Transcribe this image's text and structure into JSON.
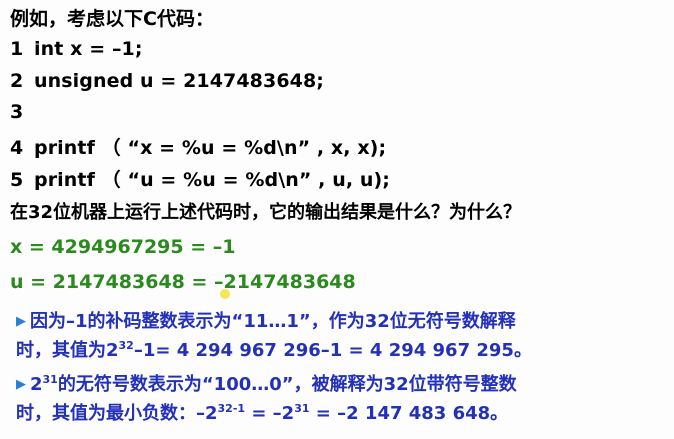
{
  "intro": "例如，考虑以下C代码：",
  "code_lines": [
    {
      "num": "1",
      "text": "int x = –1;"
    },
    {
      "num": "2",
      "text": "unsigned u = 2147483648;"
    },
    {
      "num": "3",
      "text": ""
    },
    {
      "num": "4",
      "text": "printf （ “x = %u = %d\\n” , x, x);"
    },
    {
      "num": "5",
      "text": "printf （ “u = %u = %d\\n” , u, u);"
    }
  ],
  "question": "在32位机器上运行上述代码时，它的输出结果是什么？为什么？",
  "answers": [
    "x = 4294967295 = –1",
    "u = 2147483648 = –2147483648"
  ],
  "explanations": {
    "e1_line1": "因为–1的补码整数表示为“11…1”，作为32位无符号数解释",
    "e1_line2_a": "时，其值为2",
    "e1_line2_sup": "32",
    "e1_line2_b": "–1= 4 294 967 296–1 = 4 294 967 295。",
    "e2_line1_a": "2",
    "e2_line1_sup": "31",
    "e2_line1_b": "的无符号数表示为“100…0”，被解释为32位带符号整数",
    "e2_line2_a": "时，其值为最小负数：–2",
    "e2_line2_sup1": "32-1",
    "e2_line2_b": " = –2",
    "e2_line2_sup2": "31",
    "e2_line2_c": " = –2 147 483 648。"
  },
  "bullet_icon": "triangle-bullet-icon",
  "colors": {
    "answer_green": "#2a8a1e",
    "explanation_blue": "#2330b8",
    "bullet_blue": "#2a7fd4"
  }
}
